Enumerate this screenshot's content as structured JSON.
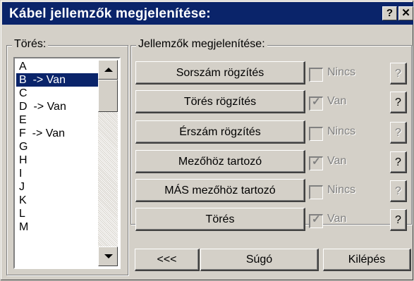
{
  "window": {
    "title": "Kábel jellemzők megjelenítése:",
    "help_button": "?",
    "close_button": "✕"
  },
  "tores_group": {
    "label": "Törés:",
    "items": [
      {
        "text": "A",
        "selected": false
      },
      {
        "text": "B  -> Van",
        "selected": true
      },
      {
        "text": "C",
        "selected": false
      },
      {
        "text": "D  -> Van",
        "selected": false
      },
      {
        "text": "E",
        "selected": false
      },
      {
        "text": "F  -> Van",
        "selected": false
      },
      {
        "text": "G",
        "selected": false
      },
      {
        "text": "H",
        "selected": false
      },
      {
        "text": "I",
        "selected": false
      },
      {
        "text": "J",
        "selected": false
      },
      {
        "text": "K",
        "selected": false
      },
      {
        "text": "L",
        "selected": false
      },
      {
        "text": "M",
        "selected": false
      }
    ]
  },
  "features_group": {
    "label": "Jellemzők megjelenítése:",
    "rows": [
      {
        "button": "Sorszám rögzítés",
        "checked": false,
        "state": "Nincs",
        "help": "?",
        "help_enabled": false
      },
      {
        "button": "Törés rögzítés",
        "checked": true,
        "state": "Van",
        "help": "?",
        "help_enabled": true
      },
      {
        "button": "Érszám rögzítés",
        "checked": false,
        "state": "Nincs",
        "help": "?",
        "help_enabled": false
      },
      {
        "button": "Mezőhöz tartozó",
        "checked": true,
        "state": "Van",
        "help": "?",
        "help_enabled": true
      },
      {
        "button": "MÁS mezőhöz tartozó",
        "checked": false,
        "state": "Nincs",
        "help": "?",
        "help_enabled": false
      },
      {
        "button": "Törés",
        "checked": true,
        "state": "Van",
        "help": "?",
        "help_enabled": true
      }
    ]
  },
  "bottom_buttons": {
    "back": "<<<",
    "help": "Súgó",
    "exit": "Kilépés"
  },
  "colors": {
    "face": "#d4d0c8",
    "title_bar": "#0a246a",
    "selection": "#0a246a",
    "disabled_text": "#808080"
  }
}
